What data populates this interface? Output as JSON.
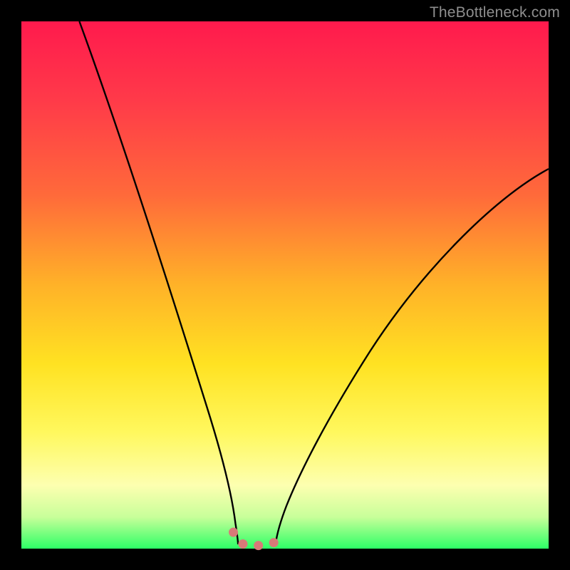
{
  "watermark": "TheBottleneck.com",
  "colors": {
    "frame": "#000000",
    "gradient_top": "#ff1a4d",
    "gradient_bottom": "#2dff66",
    "curve_stroke": "#000000",
    "marker_stroke": "#d77a78"
  },
  "chart_data": {
    "type": "line",
    "title": "",
    "xlabel": "",
    "ylabel": "",
    "xlim": [
      0,
      100
    ],
    "ylim": [
      0,
      100
    ],
    "note": "No axis ticks, tick labels, legend, or numeric data labels are rendered in the image; x and y values below are estimated from pixel positions on a 0–100 normalized grid where y=100 is the top edge and y=0 is the bottom edge.",
    "series": [
      {
        "name": "left-curve",
        "x": [
          11,
          15,
          18,
          22,
          26,
          30,
          33,
          36,
          38,
          39.5,
          40.5,
          41.1
        ],
        "y": [
          100,
          85,
          72,
          57,
          42,
          29,
          19,
          11,
          6,
          3,
          1.5,
          0.8
        ]
      },
      {
        "name": "right-curve",
        "x": [
          48.2,
          49.5,
          52,
          56,
          62,
          70,
          80,
          90,
          100
        ],
        "y": [
          0.8,
          2,
          5,
          11,
          21,
          35,
          50,
          62,
          72
        ]
      },
      {
        "name": "bottom-markers",
        "x": [
          40.2,
          41.1,
          42.3,
          43.8,
          45.4,
          46.8,
          47.9,
          48.6,
          48.8
        ],
        "y": [
          3.1,
          1.4,
          0.7,
          0.6,
          0.6,
          0.7,
          1.2,
          2.4,
          3.9
        ]
      }
    ]
  }
}
